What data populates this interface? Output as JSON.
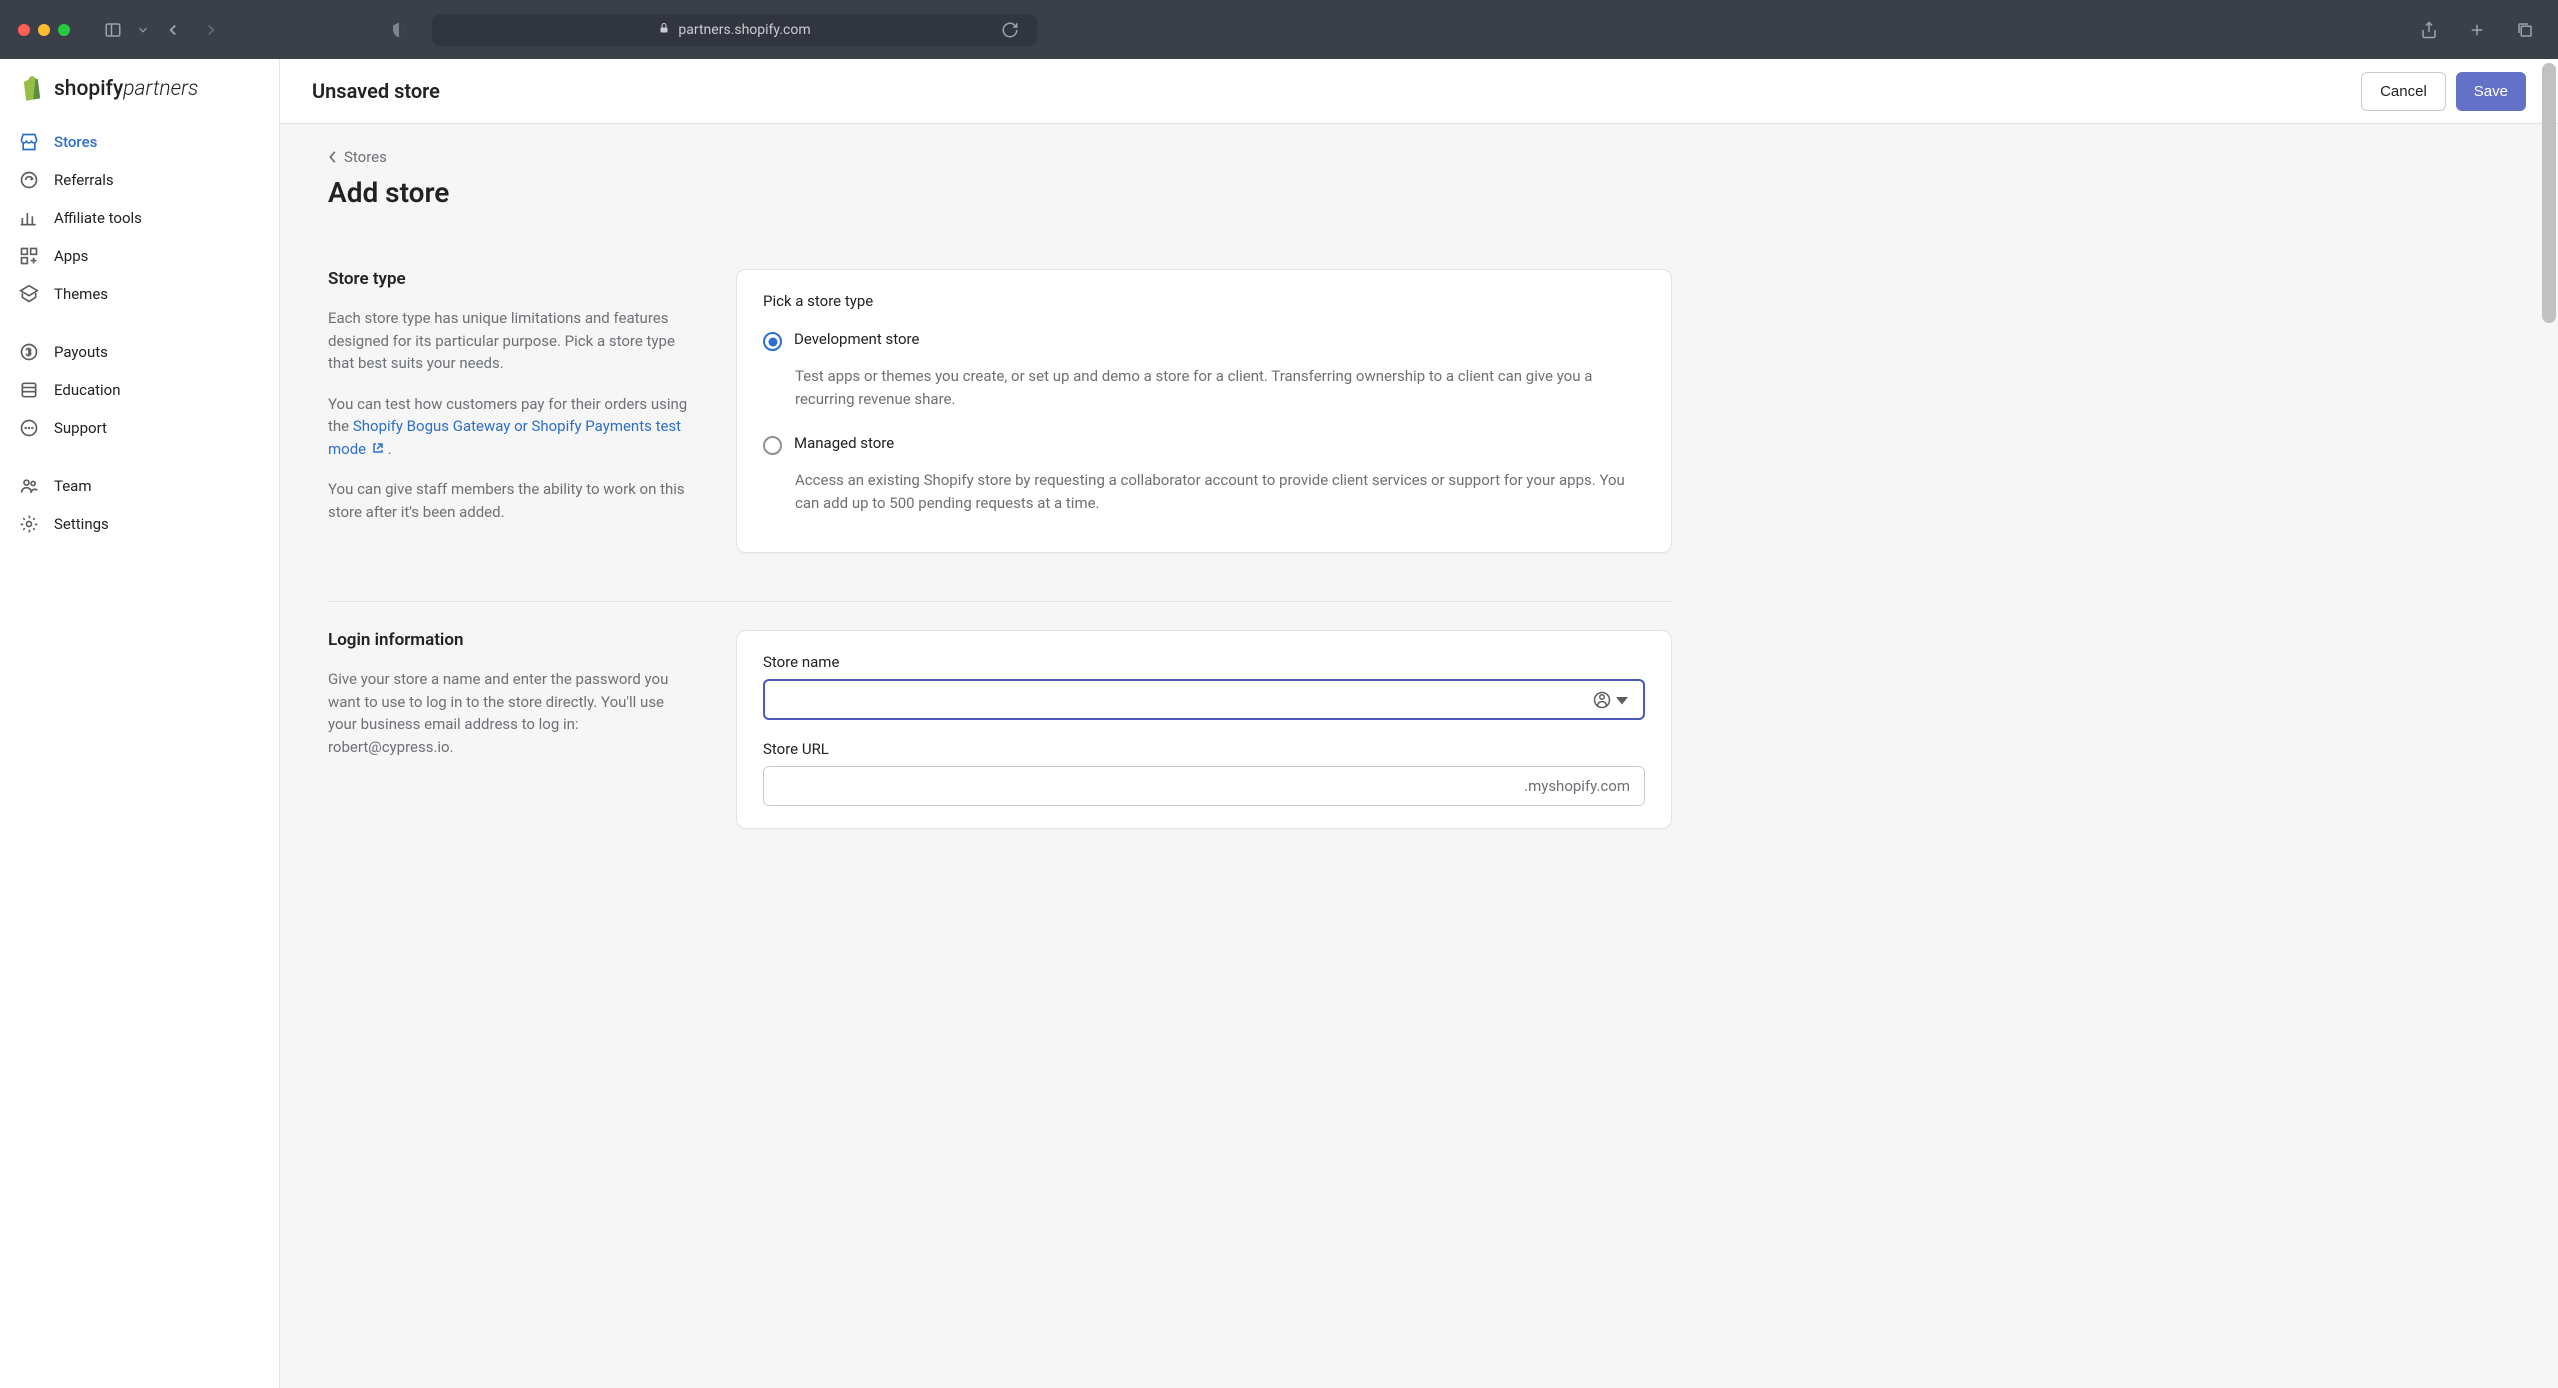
{
  "browser": {
    "url": "partners.shopify.com"
  },
  "logo": {
    "brand": "shopify",
    "suffix": "partners"
  },
  "sidebar": {
    "group1": [
      {
        "label": "Stores"
      },
      {
        "label": "Referrals"
      },
      {
        "label": "Affiliate tools"
      },
      {
        "label": "Apps"
      },
      {
        "label": "Themes"
      }
    ],
    "group2": [
      {
        "label": "Payouts"
      },
      {
        "label": "Education"
      },
      {
        "label": "Support"
      }
    ],
    "group3": [
      {
        "label": "Team"
      },
      {
        "label": "Settings"
      }
    ]
  },
  "topbar": {
    "title": "Unsaved store",
    "cancel": "Cancel",
    "save": "Save"
  },
  "breadcrumb": {
    "label": "Stores"
  },
  "page": {
    "title": "Add store"
  },
  "store_type": {
    "heading": "Store type",
    "p1": "Each store type has unique limitations and features designed for its particular purpose. Pick a store type that best suits your needs.",
    "p2a": "You can test how customers pay for their orders using the ",
    "link": "Shopify Bogus Gateway or Shopify Payments test mode",
    "p2b": " .",
    "p3": "You can give staff members the ability to work on this store after it's been added.",
    "card_heading": "Pick a store type",
    "options": [
      {
        "label": "Development store",
        "desc": "Test apps or themes you create, or set up and demo a store for a client. Transferring ownership to a client can give you a recurring revenue share."
      },
      {
        "label": "Managed store",
        "desc": "Access an existing Shopify store by requesting a collaborator account to provide client services or support for your apps. You can add up to 500 pending requests at a time."
      }
    ]
  },
  "login": {
    "heading": "Login information",
    "p1": "Give your store a name and enter the password you want to use to log in to the store directly. You'll use your business email address to log in: robert@cypress.io.",
    "name_label": "Store name",
    "url_label": "Store URL",
    "url_suffix": ".myshopify.com"
  }
}
